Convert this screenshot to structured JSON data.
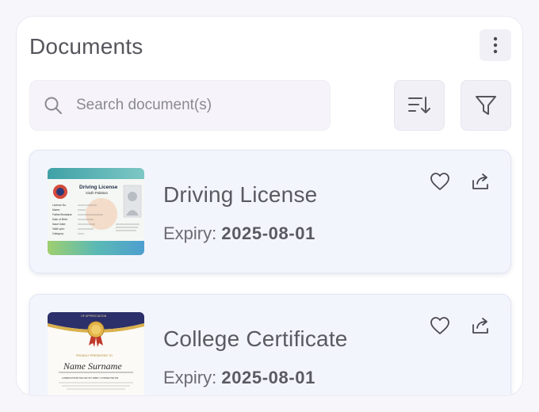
{
  "header": {
    "title": "Documents",
    "menu_icon": "more-vertical-icon"
  },
  "search": {
    "placeholder": "Search document(s)",
    "value": "",
    "icon": "search-icon"
  },
  "toolbar": {
    "sort_icon": "sort-down-icon",
    "filter_icon": "filter-icon"
  },
  "documents": [
    {
      "title": "Driving License",
      "expiry_label": "Expiry:",
      "expiry_date": "2025-08-01",
      "thumbnail": {
        "heading": "Driving License",
        "subheading": "Sindh Pakistan",
        "fields": [
          "License No.",
          "Name:",
          "Father/Husband:",
          "Date of Birth:",
          "Issue Date:",
          "Valid upto:",
          "Category:"
        ]
      }
    },
    {
      "title": "College Certificate",
      "expiry_label": "Expiry:",
      "expiry_date": "2025-08-01",
      "thumbnail": {
        "top_text": "OF APPRECIATION",
        "presented": "PROUDLY PRESENTED TO",
        "name": "Name Surname",
        "body": "LOREM IPSUM DOLOR SIT AMET, CONSECTETUR"
      }
    }
  ],
  "colors": {
    "card_bg": "#f3f5fd",
    "button_bg": "#f2f0f7",
    "text": "#5a5a61"
  }
}
